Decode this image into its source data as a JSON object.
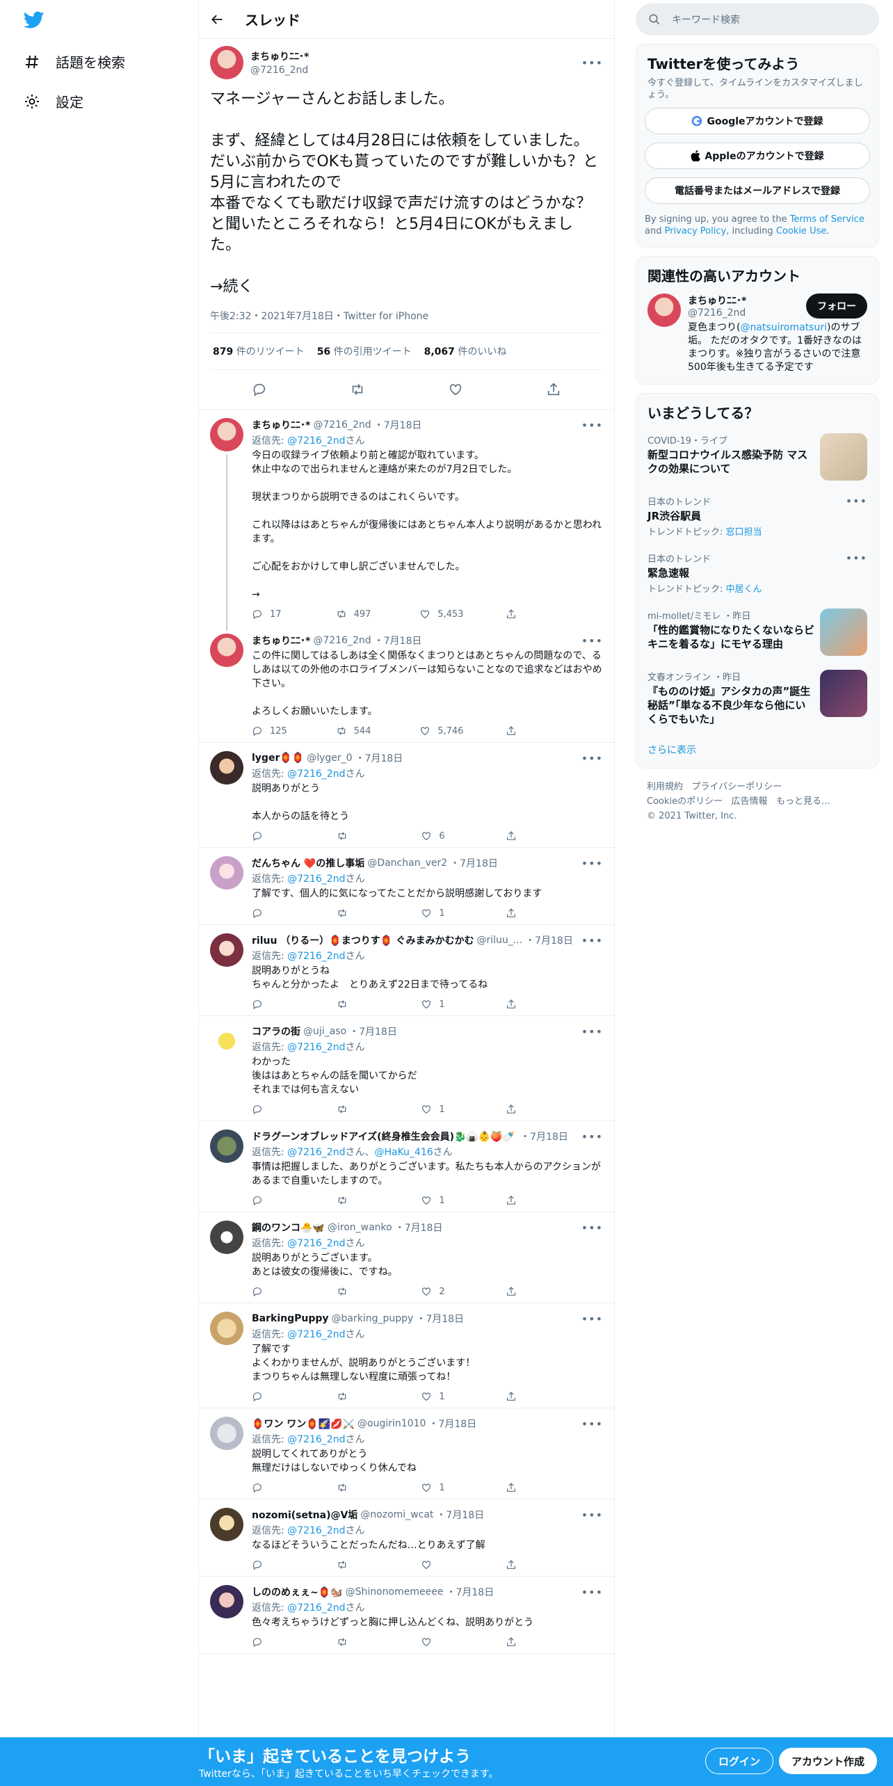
{
  "nav": {
    "explore_label": "話題を検索",
    "settings_label": "設定"
  },
  "header": {
    "title": "スレッド"
  },
  "focal": {
    "name": "まちゅりﾆﾆ･*",
    "handle": "@7216_2nd",
    "text": "マネージャーさんとお話しました。\n\nまず、経緯としては4月28日には依頼をしていました。\nだいぶ前からでOKも貰っていたのですが難しいかも？と5月に言われたので\n本番でなくても歌だけ収録で声だけ流すのはどうかな？と聞いたところそれなら！と5月4日にOKがもえました。\n\n→続く",
    "meta": "午後2:32・2021年7月18日・Twitter for iPhone",
    "retweets": "879",
    "retweets_label": "件のリツイート",
    "quotes": "56",
    "quotes_label": "件の引用ツイート",
    "likes": "8,067",
    "likes_label": "件のいいね"
  },
  "tweets": [
    {
      "name": "まちゅりﾆﾆ･*",
      "handle": "@7216_2nd",
      "time": "・7月18日",
      "reply_to": "@7216_2nd",
      "reply_suffix": "さん",
      "text": "今日の収録ライブ依頼より前と確認が取れています。\n休止中なので出られませんと連絡が来たのが7月2日でした。\n\n現状まつりから説明できるのはこれくらいです。\n\nこれ以降ははあとちゃんが復帰後にはあとちゃん本人より説明があるかと思われます。\n\nご心配をおかけして申し訳ございませんでした。\n\n→",
      "replies": "17",
      "retweets": "497",
      "likes": "5,453"
    },
    {
      "name": "まちゅりﾆﾆ･*",
      "handle": "@7216_2nd",
      "time": "・7月18日",
      "reply_to": "",
      "reply_suffix": "",
      "text": "この件に関してはるしあは全く関係なくまつりとはあとちゃんの問題なので、るしあは以ての外他のホロライブメンバーは知らないことなので追求などはおやめ下さい。\n\nよろしくお願いいたします。",
      "replies": "125",
      "retweets": "544",
      "likes": "5,746"
    },
    {
      "name": "lyger🏮🏮",
      "handle": "@lyger_0",
      "time": "・7月18日",
      "reply_to": "@7216_2nd",
      "reply_suffix": "さん",
      "text": "説明ありがとう\n\n本人からの話を待とう",
      "replies": "",
      "retweets": "",
      "likes": "6"
    },
    {
      "name": "だんちゃん ❤️の推し事垢",
      "handle": "@Danchan_ver2",
      "time": "・7月18日",
      "reply_to": "@7216_2nd",
      "reply_suffix": "さん",
      "text": "了解です、個人的に気になってたことだから説明感謝しております",
      "replies": "",
      "retweets": "",
      "likes": "1"
    },
    {
      "name": "riluu （りるー）🏮まつりす🏮 ぐみまみかむかむ",
      "handle": "@riluu_...",
      "time": "・7月18日",
      "reply_to": "@7216_2nd",
      "reply_suffix": "さん",
      "text": "説明ありがとうね\nちゃんと分かったよ　とりあえず22日まで待ってるね",
      "replies": "",
      "retweets": "",
      "likes": "1"
    },
    {
      "name": "コアラの街",
      "handle": "@uji_aso",
      "time": "・7月18日",
      "reply_to": "@7216_2nd",
      "reply_suffix": "さん",
      "text": "わかった\n後ははあとちゃんの話を聞いてからだ\nそれまでは何も言えない",
      "replies": "",
      "retweets": "",
      "likes": "1"
    },
    {
      "name": "ドラグーンオブレッドアイズ(終身椎生会会員)🐉🍙👶🍑🍼",
      "handle": "",
      "time": "・7月18日",
      "reply_to": "@7216_2nd",
      "reply_suffix": "さん、",
      "reply_to2": "@HaKu_416",
      "reply_suffix2": "さん",
      "text": "事情は把握しました、ありがとうございます。私たちも本人からのアクションがあるまで自重いたしますので。",
      "replies": "",
      "retweets": "",
      "likes": "1"
    },
    {
      "name": "鋼のワンコ🐣🦋",
      "handle": "@iron_wanko",
      "time": "・7月18日",
      "reply_to": "@7216_2nd",
      "reply_suffix": "さん",
      "text": "説明ありがとうございます。\nあとは彼女の復帰後に、ですね。",
      "replies": "",
      "retweets": "",
      "likes": "2"
    },
    {
      "name": "BarkingPuppy",
      "handle": "@barking_puppy",
      "time": "・7月18日",
      "reply_to": "@7216_2nd",
      "reply_suffix": "さん",
      "text": "了解です\nよくわかりませんが、説明ありがとうございます！\nまつりちゃんは無理しない程度に頑張ってね！",
      "replies": "",
      "retweets": "",
      "likes": "1"
    },
    {
      "name": "🏮ワン ワン🏮🌠💋⚔️",
      "handle": "@ougirin1010",
      "time": "・7月18日",
      "reply_to": "@7216_2nd",
      "reply_suffix": "さん",
      "text": "説明してくれてありがとう\n無理だけはしないでゆっくり休んでね",
      "replies": "",
      "retweets": "",
      "likes": "1"
    },
    {
      "name": "nozomi(setna)@V垢",
      "handle": "@nozomi_wcat",
      "time": "・7月18日",
      "reply_to": "@7216_2nd",
      "reply_suffix": "さん",
      "text": "なるほどそういうことだったんだね…とりあえず了解",
      "replies": "",
      "retweets": "",
      "likes": ""
    },
    {
      "name": "しののめぇぇ~🏮🐿️",
      "handle": "@Shinonomemeeee",
      "time": "・7月18日",
      "reply_to": "@7216_2nd",
      "reply_suffix": "さん",
      "text": "色々考えちゃうけどずっと胸に押し込んどくね、説明ありがとう",
      "replies": "",
      "retweets": "",
      "likes": ""
    }
  ],
  "right": {
    "search_placeholder": "キーワード検索",
    "signup": {
      "title": "Twitterを使ってみよう",
      "subtitle": "今すぐ登録して、タイムラインをカスタマイズしましょう。",
      "google": "Googleアカウントで登録",
      "apple": "Appleのアカウントで登録",
      "phone": "電話番号またはメールアドレスで登録",
      "legal_1": "By signing up, you agree to the ",
      "legal_tos": "Terms of Service",
      "legal_2": " and ",
      "legal_privacy": "Privacy Policy",
      "legal_3": ", including ",
      "legal_cookie": "Cookie Use",
      "legal_4": "."
    },
    "related": {
      "title": "関連性の高いアカウント",
      "name": "まちゅりﾆﾆ･*",
      "handle": "@7216_2nd",
      "follow": "フォロー",
      "bio_1": "夏色まつり(",
      "bio_link": "@natsuiromatsuri",
      "bio_2": ")のサブ垢。 ただのオタクです。1番好きなのはまつりす。※独り言がうるさいので注意 500年後も生きてる予定です"
    },
    "trends": {
      "title": "いまどうしてる？",
      "items": [
        {
          "meta": "COVID-19・ライブ",
          "title": "新型コロナウイルス感染予防 マスクの効果について",
          "sub": "",
          "sub_link": ""
        },
        {
          "meta": "日本のトレンド",
          "title": "JR渋谷駅員",
          "sub": "トレンドトピック: ",
          "sub_link": "窓口担当"
        },
        {
          "meta": "日本のトレンド",
          "title": "緊急速報",
          "sub": "トレンドトピック: ",
          "sub_link": "中居くん"
        },
        {
          "meta": "mi-mollet/ミモレ ・昨日",
          "title": "「性的鑑賞物になりたくないならビキニを着るな」にモヤる理由",
          "sub": "",
          "sub_link": ""
        },
        {
          "meta": "文春オンライン ・昨日",
          "title": "『もののけ姫』アシタカの声”誕生秘話”「単なる不良少年なら他にいくらでもいた」",
          "sub": "",
          "sub_link": ""
        }
      ],
      "show_more": "さらに表示"
    },
    "footer": {
      "terms": "利用規約",
      "privacy": "プライバシーポリシー",
      "cookie": "Cookieのポリシー",
      "ads": "広告情報",
      "more": "もっと見る…",
      "copyright": "© 2021 Twitter, Inc."
    }
  },
  "bottom": {
    "title": "「いま」起きていることを見つけよう",
    "subtitle": "Twitterなら、「いま」起きていることをいち早くチェックできます。",
    "login": "ログイン",
    "signup": "アカウント作成"
  },
  "colors": {
    "brand": "#1da1f2",
    "link": "#1b95e0",
    "text_secondary": "#5b7083"
  }
}
